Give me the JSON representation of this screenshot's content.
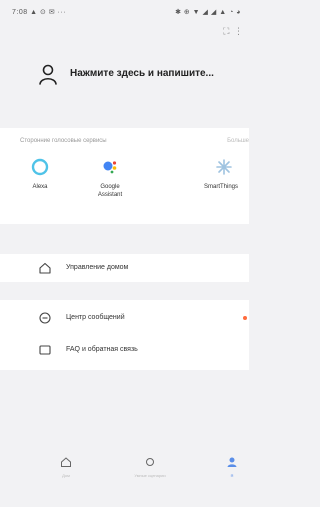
{
  "status_bar": {
    "left": "7:08 ▲ ⊙ ✉ ···",
    "right": "✱ ⊕ ▼ ◢ ◢ ▲ ◔ ◕"
  },
  "profile": {
    "prompt": "Нажмите здесь и напишите..."
  },
  "voice_services": {
    "title": "Сторонние голосовые сервисы",
    "more": "Больше",
    "items": [
      {
        "name": "Alexa",
        "icon": "alexa-icon",
        "color": "#4fc3e8"
      },
      {
        "name": "Google Assistant",
        "icon": "google-assistant-icon",
        "color": "#4285f4"
      },
      {
        "name": "SmartThings",
        "icon": "smartthings-icon",
        "color": "#9fc3e0"
      }
    ]
  },
  "menu": {
    "home_control": "Управление домом",
    "messages": "Центр сообщений",
    "faq": "FAQ и обратная связь"
  },
  "tabs": [
    {
      "label": "Дом",
      "icon": "home-icon"
    },
    {
      "label": "Умные сценарии",
      "icon": "scene-icon"
    },
    {
      "label": "Я",
      "icon": "profile-icon",
      "active": true
    }
  ],
  "colors": {
    "accent": "#5a8ee8",
    "badge": "#ff6b3d"
  }
}
